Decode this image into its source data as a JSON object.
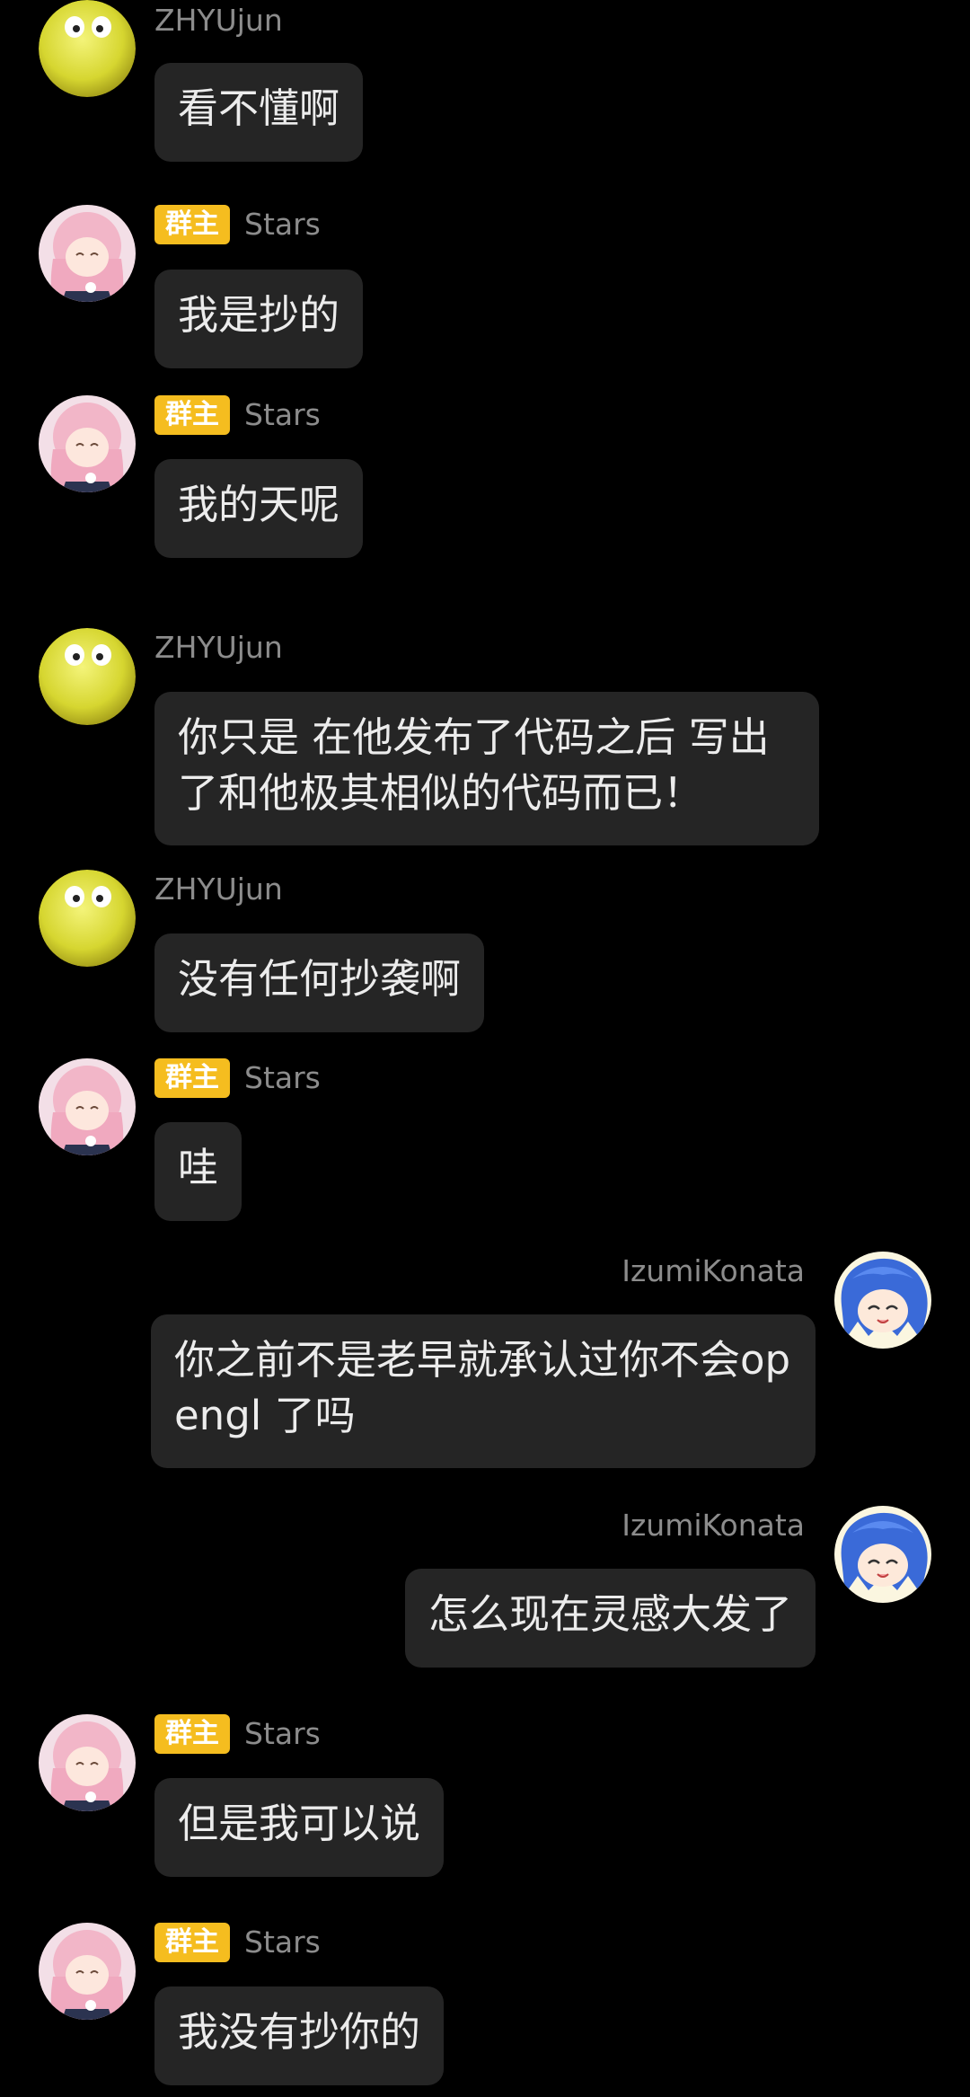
{
  "messages": [
    {
      "side": "left",
      "avatar": "yellow-face-avatar",
      "badge": "",
      "name": "ZHYUjun",
      "text": "看不懂啊"
    },
    {
      "side": "left",
      "avatar": "pink-anime-avatar",
      "badge": "群主",
      "name": "Stars",
      "text": "我是抄的"
    },
    {
      "side": "left",
      "avatar": "pink-anime-avatar",
      "badge": "群主",
      "name": "Stars",
      "text": "我的天呢"
    },
    {
      "side": "left",
      "avatar": "yellow-face-avatar",
      "badge": "",
      "name": "ZHYUjun",
      "text": "你只是 在他发布了代码之后 写出了和他极其相似的代码而已！"
    },
    {
      "side": "left",
      "avatar": "yellow-face-avatar",
      "badge": "",
      "name": "ZHYUjun",
      "text": "没有任何抄袭啊"
    },
    {
      "side": "left",
      "avatar": "pink-anime-avatar",
      "badge": "群主",
      "name": "Stars",
      "text": "哇"
    },
    {
      "side": "right",
      "avatar": "blue-anime-avatar",
      "badge": "",
      "name": "IzumiKonata",
      "text": "你之前不是老早就承认过你不会opengl 了吗"
    },
    {
      "side": "right",
      "avatar": "blue-anime-avatar",
      "badge": "",
      "name": "IzumiKonata",
      "text": "怎么现在灵感大发了"
    },
    {
      "side": "left",
      "avatar": "pink-anime-avatar",
      "badge": "群主",
      "name": "Stars",
      "text": "但是我可以说"
    },
    {
      "side": "left",
      "avatar": "pink-anime-avatar",
      "badge": "群主",
      "name": "Stars",
      "text": "我没有抄你的"
    }
  ],
  "colors": {
    "background": "#000000",
    "bubble": "#252525",
    "badge": "#f5bd1f",
    "name": "#8c8c8c"
  }
}
